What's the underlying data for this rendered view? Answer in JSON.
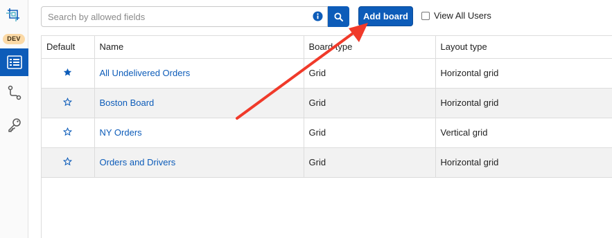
{
  "env_badge": "DEV",
  "search": {
    "placeholder": "Search by allowed fields"
  },
  "toolbar": {
    "add_board_label": "Add board",
    "view_all_users_label": "View All Users"
  },
  "table": {
    "headers": [
      "Default",
      "Name",
      "Board type",
      "Layout type"
    ],
    "rows": [
      {
        "default": true,
        "name": "All Undelivered Orders",
        "board_type": "Grid",
        "layout_type": "Horizontal grid"
      },
      {
        "default": false,
        "name": "Boston Board",
        "board_type": "Grid",
        "layout_type": "Horizontal grid"
      },
      {
        "default": false,
        "name": "NY Orders",
        "board_type": "Grid",
        "layout_type": "Vertical grid"
      },
      {
        "default": false,
        "name": "Orders and Drivers",
        "board_type": "Grid",
        "layout_type": "Horizontal grid"
      }
    ]
  },
  "colors": {
    "accent": "#0d5cb9",
    "annotation_arrow": "#f03a2a",
    "dev_badge": "#fbd9a6"
  }
}
